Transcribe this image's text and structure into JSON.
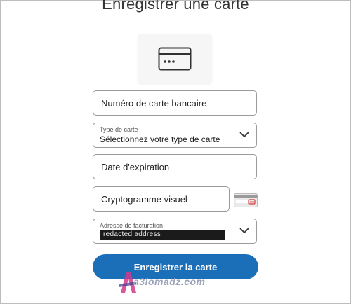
{
  "page": {
    "title": "Enregistrer une carte"
  },
  "card_illustration": {
    "icon": "credit-card-icon"
  },
  "form": {
    "card_number_label": "Numéro de carte bancaire",
    "card_type": {
      "label": "Type de carte",
      "value": "Sélectionnez votre type de carte"
    },
    "expiry_label": "Date d'expiration",
    "cvv_label": "Cryptogramme visuel",
    "billing": {
      "label": "Adresse de facturation",
      "value": "redacted address"
    },
    "submit_label": "Enregistrer la carte"
  },
  "watermark": {
    "text": "a3lomadz.com"
  },
  "colors": {
    "primary": "#1a6fb8",
    "cvv_accent": "#d33c3c"
  }
}
